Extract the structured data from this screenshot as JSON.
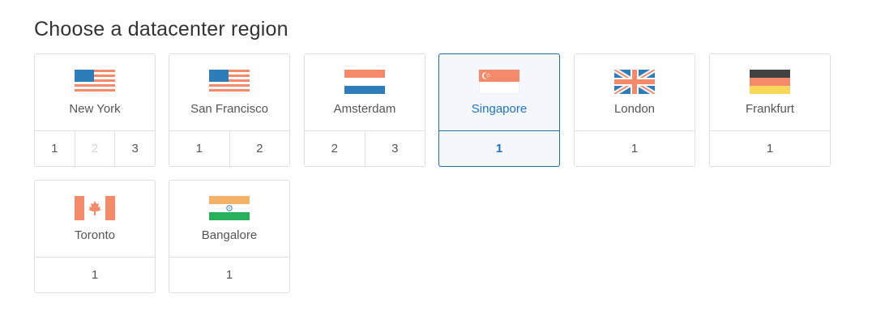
{
  "heading": "Choose a datacenter region",
  "colors": {
    "selected_border": "#1d6fa8",
    "selected_text": "#1f73c7",
    "card_border": "#dfdfdf",
    "disabled_text": "#d4d4d4"
  },
  "regions": [
    {
      "name": "New York",
      "flag": "us-flag-icon",
      "numbers": [
        "1",
        "2",
        "3"
      ],
      "disabled": [
        "2"
      ],
      "selected": false
    },
    {
      "name": "San Francisco",
      "flag": "us-flag-icon",
      "numbers": [
        "1",
        "2"
      ],
      "selected": false
    },
    {
      "name": "Amsterdam",
      "flag": "netherlands-flag-icon",
      "numbers": [
        "2",
        "3"
      ],
      "selected": false
    },
    {
      "name": "Singapore",
      "flag": "singapore-flag-icon",
      "numbers": [
        "1"
      ],
      "selected": true
    },
    {
      "name": "London",
      "flag": "uk-flag-icon",
      "numbers": [
        "1"
      ],
      "selected": false
    },
    {
      "name": "Frankfurt",
      "flag": "germany-flag-icon",
      "numbers": [
        "1"
      ],
      "selected": false
    },
    {
      "name": "Toronto",
      "flag": "canada-flag-icon",
      "numbers": [
        "1"
      ],
      "selected": false
    },
    {
      "name": "Bangalore",
      "flag": "india-flag-icon",
      "numbers": [
        "1"
      ],
      "selected": false
    }
  ]
}
